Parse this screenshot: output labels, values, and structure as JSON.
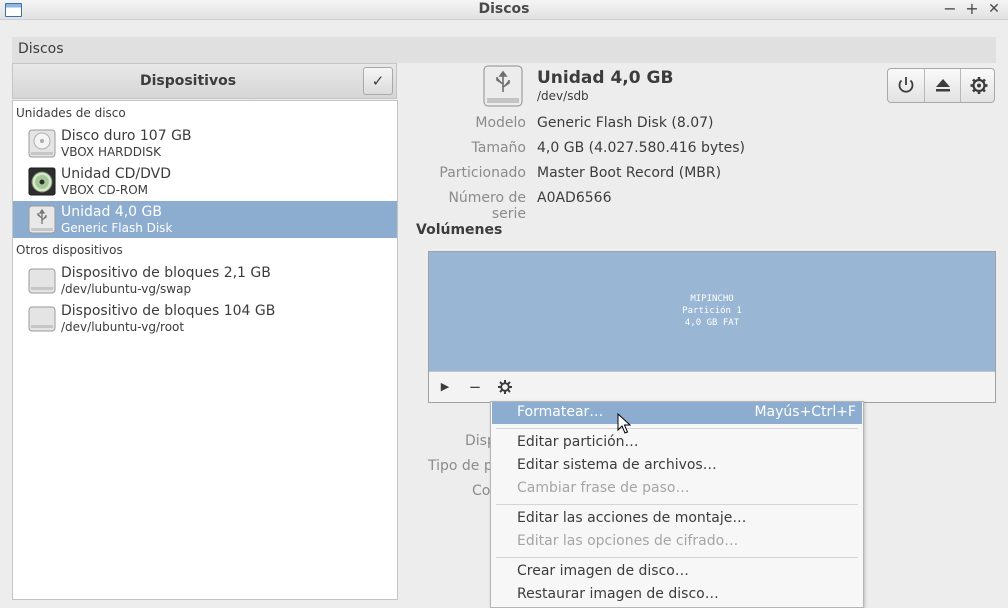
{
  "window": {
    "title": "Discos",
    "minimize": "−",
    "maximize": "+",
    "close": "✕"
  },
  "menubar": {
    "label": "Discos"
  },
  "sidebar": {
    "header": "Dispositivos",
    "check": "✓",
    "sections": [
      {
        "title": "Unidades de disco"
      },
      {
        "title": "Otros dispositivos"
      }
    ],
    "items": [
      {
        "name": "Disco duro 107 GB",
        "sub": "VBOX HARDDISK",
        "icon": "harddisk-icon"
      },
      {
        "name": "Unidad CD/DVD",
        "sub": "VBOX CD-ROM",
        "icon": "optical-disc-icon"
      },
      {
        "name": "Unidad 4,0 GB",
        "sub": "Generic Flash Disk",
        "icon": "usb-drive-icon",
        "selected": true
      },
      {
        "name": "Dispositivo de bloques 2,1 GB",
        "sub": "/dev/lubuntu-vg/swap",
        "icon": "block-device-icon"
      },
      {
        "name": "Dispositivo de bloques 104 GB",
        "sub": "/dev/lubuntu-vg/root",
        "icon": "block-device-icon"
      }
    ]
  },
  "drive": {
    "title": "Unidad 4,0 GB",
    "path": "/dev/sdb",
    "info": [
      {
        "label": "Modelo",
        "value": "Generic Flash Disk (8.07)"
      },
      {
        "label": "Tamaño",
        "value": "4,0 GB (4.027.580.416 bytes)"
      },
      {
        "label": "Particionado",
        "value": "Master Boot Record (MBR)"
      },
      {
        "label": "Número de serie",
        "value": "A0AD6566"
      }
    ],
    "toolbar": [
      "power-icon",
      "eject-icon",
      "gear-icon"
    ]
  },
  "volumes": {
    "heading": "Volúmenes",
    "partition": {
      "line1": "MIPINCHO",
      "line2": "Partición 1",
      "line3": "4,0 GB FAT"
    },
    "tools": {
      "play": "▶",
      "minus": "−"
    }
  },
  "hidden_labels": [
    "Disp",
    "Tipo de p",
    "Co"
  ],
  "context_menu": {
    "items": [
      {
        "label": "Formatear…",
        "shortcut": "Mayús+Ctrl+F",
        "highlighted": true
      },
      {
        "label": "Editar partición…"
      },
      {
        "label": "Editar sistema de archivos…"
      },
      {
        "label": "Cambiar frase de paso…",
        "disabled": true
      },
      {
        "label": "Editar las acciones de montaje…"
      },
      {
        "label": "Editar las opciones de cifrado…",
        "disabled": true
      },
      {
        "label": "Crear imagen de disco…"
      },
      {
        "label": "Restaurar imagen de disco…"
      }
    ]
  },
  "colors": {
    "selection": "#8cadcf",
    "partition": "#99b6d4"
  }
}
